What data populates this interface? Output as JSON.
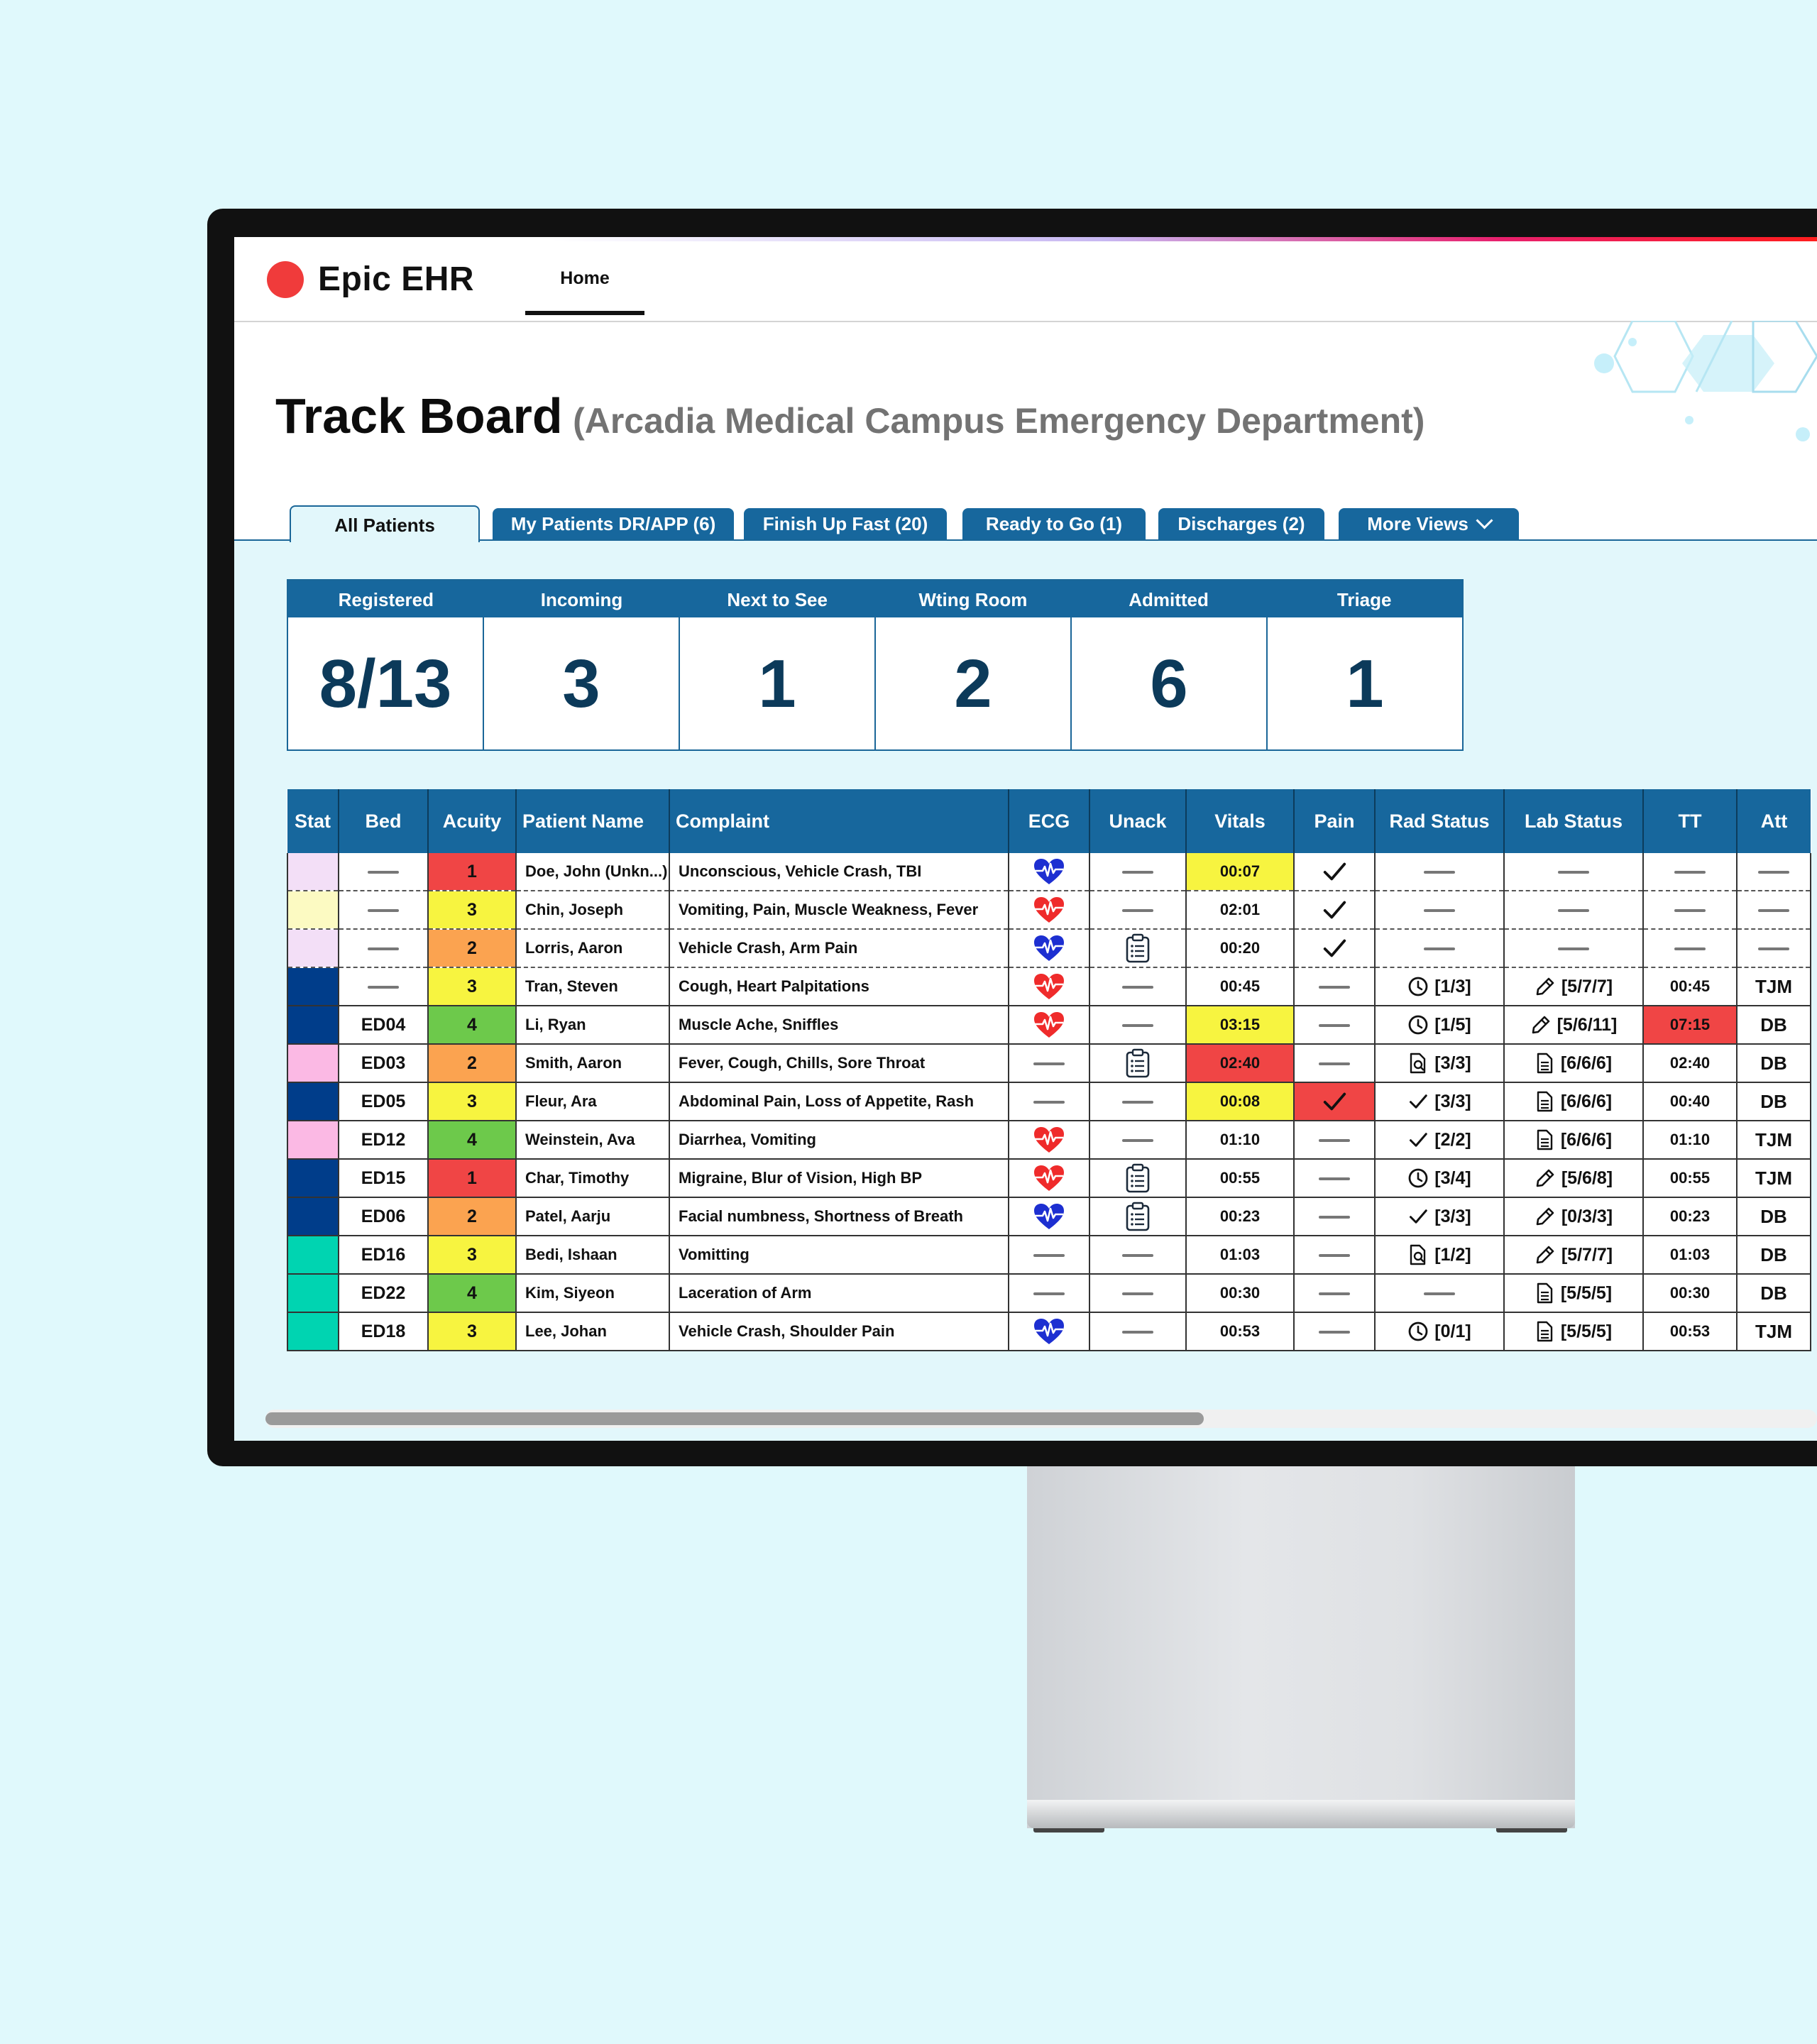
{
  "app": {
    "title": "Epic EHR"
  },
  "nav": {
    "home": "Home"
  },
  "page": {
    "title": "Track Board",
    "subtitle": "(Arcadia Medical Campus Emergency Department)"
  },
  "tabs": [
    "All Patients",
    "My Patients DR/APP (6)",
    "Finish Up Fast (20)",
    "Ready to Go (1)",
    "Discharges (2)",
    "More Views"
  ],
  "stats": [
    {
      "label": "Registered",
      "value": "8/13"
    },
    {
      "label": "Incoming",
      "value": "3"
    },
    {
      "label": "Next to See",
      "value": "1"
    },
    {
      "label": "Wting Room",
      "value": "2"
    },
    {
      "label": "Admitted",
      "value": "6"
    },
    {
      "label": "Triage",
      "value": "1"
    }
  ],
  "columns": [
    "Stat",
    "Bed",
    "Acuity",
    "Patient Name",
    "Complaint",
    "ECG",
    "Unack",
    "Vitals",
    "Pain",
    "Rad Status",
    "Lab Status",
    "TT",
    "Att"
  ],
  "colors": {
    "header_blue": "#17679d",
    "acuity_1": "#f04545",
    "acuity_2": "#fba350",
    "acuity_3": "#f7f440",
    "acuity_4": "#6dc94b",
    "vitals_warn": "#f7f440",
    "vitals_alert": "#f04545",
    "ecg_blue": "#1d2fd1",
    "ecg_red": "#ef2b2b"
  },
  "rows": [
    {
      "stat_color": "#f3dff7",
      "bed": "",
      "acuity": "1",
      "name": "Doe, John (Unkn...)",
      "complaint": "Unconscious, Vehicle Crash, TBI",
      "ecg": "blue",
      "unack": "",
      "vitals": "00:07",
      "vitals_flag": "warn",
      "pain": "check",
      "pain_flag": "",
      "rad": "",
      "rad_icon": "",
      "lab": "",
      "lab_icon": "",
      "tt": "",
      "tt_flag": "",
      "att": ""
    },
    {
      "stat_color": "#fcfac2",
      "bed": "",
      "acuity": "3",
      "name": "Chin, Joseph",
      "complaint": "Vomiting, Pain, Muscle Weakness, Fever",
      "ecg": "red",
      "unack": "",
      "vitals": "02:01",
      "vitals_flag": "",
      "pain": "check",
      "pain_flag": "",
      "rad": "",
      "rad_icon": "",
      "lab": "",
      "lab_icon": "",
      "tt": "",
      "tt_flag": "",
      "att": ""
    },
    {
      "stat_color": "#f3dff7",
      "bed": "",
      "acuity": "2",
      "name": "Lorris, Aaron",
      "complaint": "Vehicle Crash, Arm Pain",
      "ecg": "blue",
      "unack": "clipboard",
      "vitals": "00:20",
      "vitals_flag": "",
      "pain": "check",
      "pain_flag": "",
      "rad": "",
      "rad_icon": "",
      "lab": "",
      "lab_icon": "",
      "tt": "",
      "tt_flag": "",
      "att": ""
    },
    {
      "stat_color": "#003d8a",
      "bed": "",
      "acuity": "3",
      "name": "Tran, Steven",
      "complaint": "Cough, Heart Palpitations",
      "ecg": "red",
      "unack": "",
      "vitals": "00:45",
      "vitals_flag": "",
      "pain": "",
      "pain_flag": "",
      "rad": "[1/3]",
      "rad_icon": "clock",
      "lab": "[5/7/7]",
      "lab_icon": "pen",
      "tt": "00:45",
      "tt_flag": "",
      "att": "TJM"
    },
    {
      "stat_color": "#003d8a",
      "bed": "ED04",
      "acuity": "4",
      "name": "Li, Ryan",
      "complaint": "Muscle Ache, Sniffles",
      "ecg": "red",
      "unack": "",
      "vitals": "03:15",
      "vitals_flag": "warn",
      "pain": "",
      "pain_flag": "",
      "rad": "[1/5]",
      "rad_icon": "clock",
      "lab": "[5/6/11]",
      "lab_icon": "pen",
      "tt": "07:15",
      "tt_flag": "alert",
      "att": "DB"
    },
    {
      "stat_color": "#fbb9e4",
      "bed": "ED03",
      "acuity": "2",
      "name": "Smith, Aaron",
      "complaint": "Fever, Cough, Chills, Sore Throat",
      "ecg": "",
      "unack": "clipboard",
      "vitals": "02:40",
      "vitals_flag": "alert",
      "pain": "",
      "pain_flag": "",
      "rad": "[3/3]",
      "rad_icon": "search",
      "lab": "[6/6/6]",
      "lab_icon": "doc",
      "tt": "02:40",
      "tt_flag": "",
      "att": "DB"
    },
    {
      "stat_color": "#003d8a",
      "bed": "ED05",
      "acuity": "3",
      "name": "Fleur, Ara",
      "complaint": "Abdominal Pain, Loss of Appetite, Rash",
      "ecg": "",
      "unack": "",
      "vitals": "00:08",
      "vitals_flag": "warn",
      "pain": "check",
      "pain_flag": "alert",
      "rad": "[3/3]",
      "rad_icon": "check",
      "lab": "[6/6/6]",
      "lab_icon": "doc",
      "tt": "00:40",
      "tt_flag": "",
      "att": "DB"
    },
    {
      "stat_color": "#fbb9e4",
      "bed": "ED12",
      "acuity": "4",
      "name": "Weinstein, Ava",
      "complaint": "Diarrhea, Vomiting",
      "ecg": "red",
      "unack": "",
      "vitals": "01:10",
      "vitals_flag": "",
      "pain": "",
      "pain_flag": "",
      "rad": "[2/2]",
      "rad_icon": "check",
      "lab": "[6/6/6]",
      "lab_icon": "doc",
      "tt": "01:10",
      "tt_flag": "",
      "att": "TJM"
    },
    {
      "stat_color": "#003d8a",
      "bed": "ED15",
      "acuity": "1",
      "name": "Char, Timothy",
      "complaint": "Migraine, Blur of Vision, High BP",
      "ecg": "red",
      "unack": "clipboard",
      "vitals": "00:55",
      "vitals_flag": "",
      "pain": "",
      "pain_flag": "",
      "rad": "[3/4]",
      "rad_icon": "clock",
      "lab": "[5/6/8]",
      "lab_icon": "pen",
      "tt": "00:55",
      "tt_flag": "",
      "att": "TJM"
    },
    {
      "stat_color": "#003d8a",
      "bed": "ED06",
      "acuity": "2",
      "name": "Patel, Aarju",
      "complaint": "Facial numbness, Shortness of Breath",
      "ecg": "blue",
      "unack": "clipboard",
      "vitals": "00:23",
      "vitals_flag": "",
      "pain": "",
      "pain_flag": "",
      "rad": "[3/3]",
      "rad_icon": "check",
      "lab": "[0/3/3]",
      "lab_icon": "pen",
      "tt": "00:23",
      "tt_flag": "",
      "att": "DB"
    },
    {
      "stat_color": "#00d4b1",
      "bed": "ED16",
      "acuity": "3",
      "name": "Bedi, Ishaan",
      "complaint": "Vomitting",
      "ecg": "",
      "unack": "",
      "vitals": "01:03",
      "vitals_flag": "",
      "pain": "",
      "pain_flag": "",
      "rad": "[1/2]",
      "rad_icon": "search",
      "lab": "[5/7/7]",
      "lab_icon": "pen",
      "tt": "01:03",
      "tt_flag": "",
      "att": "DB"
    },
    {
      "stat_color": "#00d4b1",
      "bed": "ED22",
      "acuity": "4",
      "name": "Kim, Siyeon",
      "complaint": "Laceration of Arm",
      "ecg": "",
      "unack": "",
      "vitals": "00:30",
      "vitals_flag": "",
      "pain": "",
      "pain_flag": "",
      "rad": "",
      "rad_icon": "",
      "lab": "[5/5/5]",
      "lab_icon": "doc",
      "tt": "00:30",
      "tt_flag": "",
      "att": "DB"
    },
    {
      "stat_color": "#00d4b1",
      "bed": "ED18",
      "acuity": "3",
      "name": "Lee, Johan",
      "complaint": "Vehicle Crash, Shoulder Pain",
      "ecg": "blue",
      "unack": "",
      "vitals": "00:53",
      "vitals_flag": "",
      "pain": "",
      "pain_flag": "",
      "rad": "[0/1]",
      "rad_icon": "clock",
      "lab": "[5/5/5]",
      "lab_icon": "doc",
      "tt": "00:53",
      "tt_flag": "",
      "att": "TJM"
    }
  ]
}
